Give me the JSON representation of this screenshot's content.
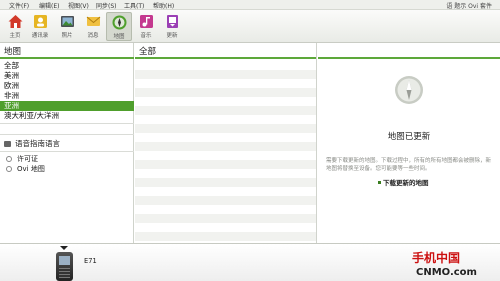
{
  "menu": {
    "items": [
      "文件(F)",
      "编辑(E)",
      "视图(V)",
      "同步(S)",
      "工具(T)",
      "帮助(H)"
    ],
    "account": "语 题示 Ovi 套件"
  },
  "toolbar": {
    "items": [
      {
        "label": "主页",
        "icon": "house-icon"
      },
      {
        "label": "通讯录",
        "icon": "contacts-icon"
      },
      {
        "label": "照片",
        "icon": "photos-icon"
      },
      {
        "label": "消息",
        "icon": "message-icon"
      },
      {
        "label": "地图",
        "icon": "maps-icon",
        "active": true
      },
      {
        "label": "音乐",
        "icon": "music-icon"
      },
      {
        "label": "更新",
        "icon": "update-icon"
      }
    ]
  },
  "left": {
    "title": "地图",
    "regions": [
      "全部",
      "美洲",
      "欧洲",
      "非洲",
      "亚洲",
      "澳大利亚/大洋洲"
    ],
    "selected_region": "亚洲",
    "voice_label": "语音指南语言",
    "license_items": [
      "许可证",
      "Ovi 地图"
    ]
  },
  "middle": {
    "title": "全部"
  },
  "right": {
    "heading": "地图已更新",
    "description": "需要下载更新的地图。下载过程中，所有的所有地图都会被删除，新地图将替换至设备。您可能要等一些时间。",
    "download_label": "下载更新的地图"
  },
  "device": {
    "name": "E71"
  },
  "logo": {
    "brand_cn": "手机中国",
    "brand_en": "CNMO.com",
    "color": "#cc1111"
  },
  "colors": {
    "accent_green": "#4f9f2c",
    "title_line": "#5da83a"
  }
}
